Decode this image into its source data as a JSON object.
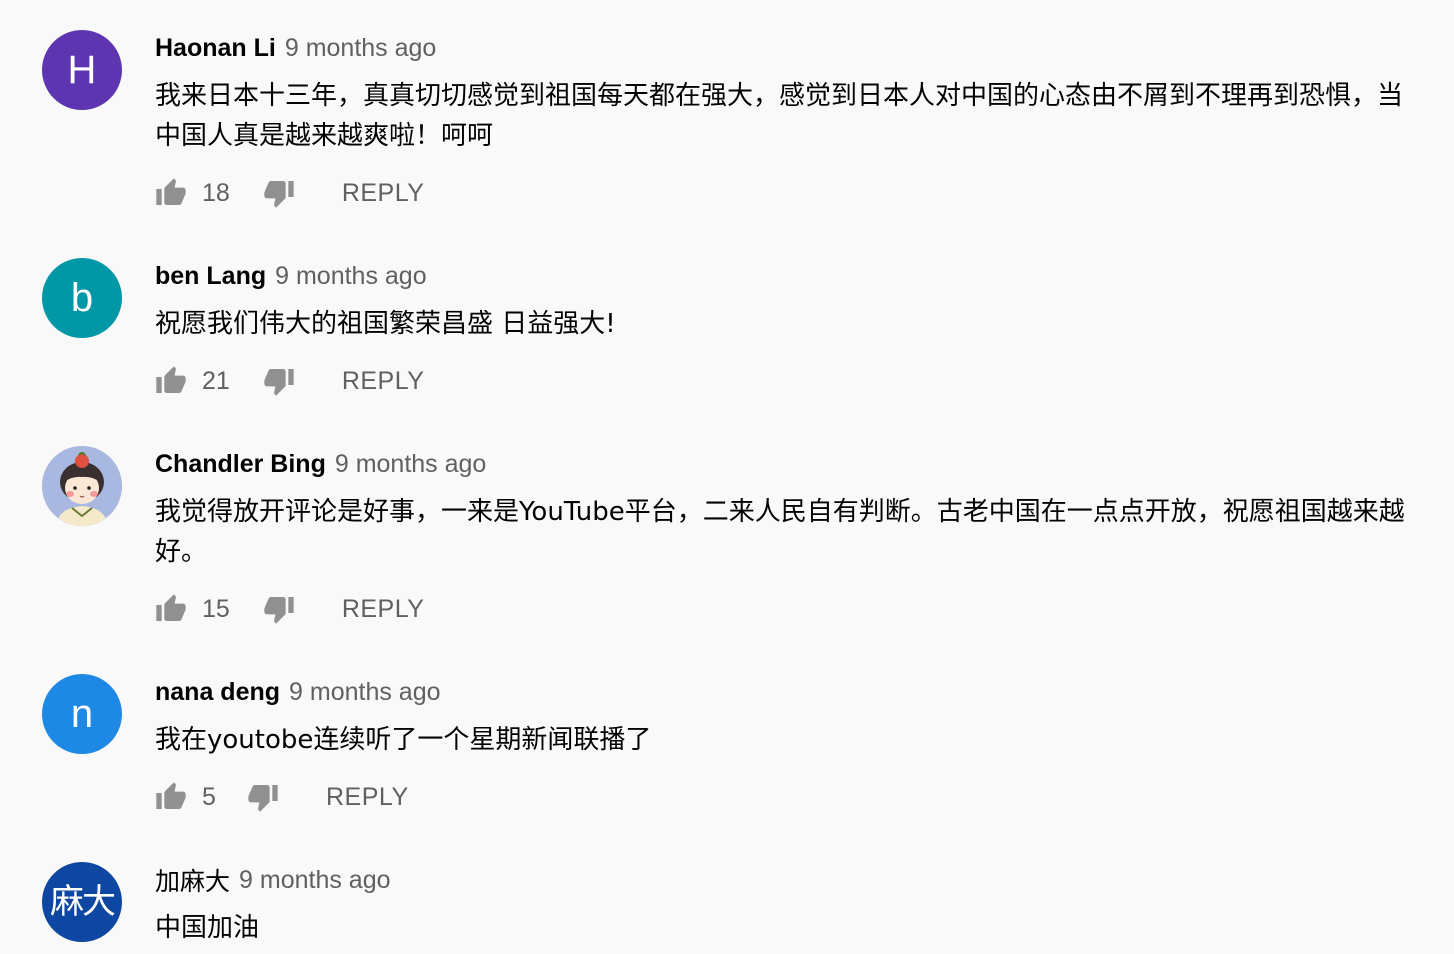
{
  "comments": [
    {
      "author": "Haonan Li",
      "time": "9 months ago",
      "avatar_letter": "H",
      "avatar_color": "#5e35b1",
      "text": "我来日本十三年，真真切切感觉到祖国每天都在强大，感觉到日本人对中国的心态由不屑到不理再到恐惧，当中国人真是越来越爽啦！呵呵",
      "likes": "18",
      "reply_label": "REPLY"
    },
    {
      "author": "ben Lang",
      "time": "9 months ago",
      "avatar_letter": "b",
      "avatar_color": "#0097a7",
      "text": "祝愿我们伟大的祖国繁荣昌盛 日益强大!",
      "likes": "21",
      "reply_label": "REPLY"
    },
    {
      "author": "Chandler Bing",
      "time": "9 months ago",
      "avatar_letter": "",
      "avatar_color": "#a9b8e0",
      "text": "我觉得放开评论是好事，一来是YouTube平台，二来人民自有判断。古老中国在一点点开放，祝愿祖国越来越好。",
      "likes": "15",
      "reply_label": "REPLY"
    },
    {
      "author": "nana deng",
      "time": "9 months ago",
      "avatar_letter": "n",
      "avatar_color": "#1e88e5",
      "text": "我在youtobe连续听了一个星期新闻联播了",
      "likes": "5",
      "reply_label": "REPLY"
    },
    {
      "author": "加麻大",
      "time": "9 months ago",
      "avatar_letter": "麻大",
      "avatar_color": "#0d47a1",
      "text": "中国加油",
      "likes": "",
      "reply_label": ""
    }
  ],
  "icons": {
    "like": "thumb-up-icon",
    "dislike": "thumb-down-icon",
    "illustrated_avatar": "cartoon-avatar"
  }
}
